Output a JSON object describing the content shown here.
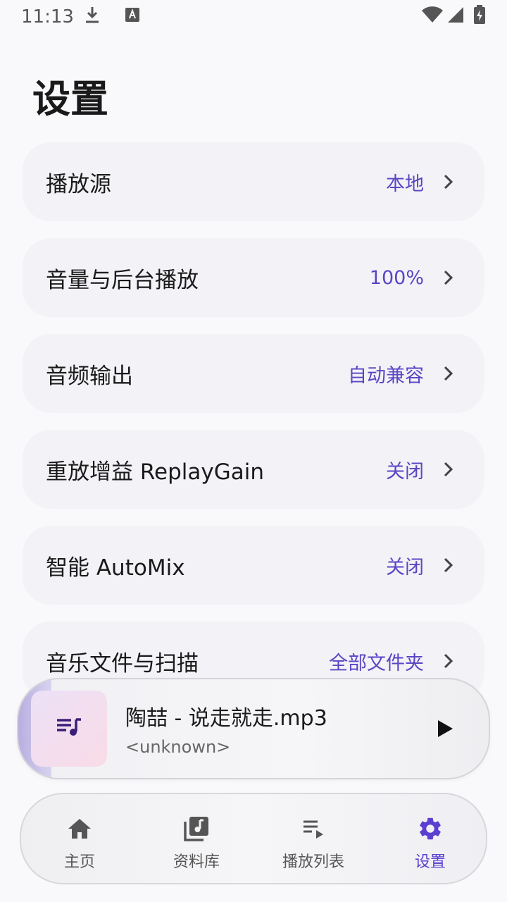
{
  "status_bar": {
    "time": "11:13"
  },
  "page": {
    "title": "设置"
  },
  "settings": [
    {
      "label": "播放源",
      "value": "本地"
    },
    {
      "label": "音量与后台播放",
      "value": "100%"
    },
    {
      "label": "音频输出",
      "value": "自动兼容"
    },
    {
      "label": "重放增益 ReplayGain",
      "value": "关闭"
    },
    {
      "label": "智能 AutoMix",
      "value": "关闭"
    },
    {
      "label": "音乐文件与扫描",
      "value": "全部文件夹"
    }
  ],
  "mini_player": {
    "title": "陶喆 - 说走就走.mp3",
    "artist": "<unknown>",
    "progress": 0.07
  },
  "bottom_nav": {
    "items": [
      {
        "label": "主页",
        "icon": "home-icon"
      },
      {
        "label": "资料库",
        "icon": "library-music-icon"
      },
      {
        "label": "播放列表",
        "icon": "playlist-play-icon"
      },
      {
        "label": "设置",
        "icon": "gear-icon"
      }
    ],
    "active_index": 3
  },
  "colors": {
    "accent": "#5b3fd1",
    "value_text": "#5b45c4",
    "card_bg": "#f3f2f7",
    "page_bg": "#f9f9fb"
  }
}
